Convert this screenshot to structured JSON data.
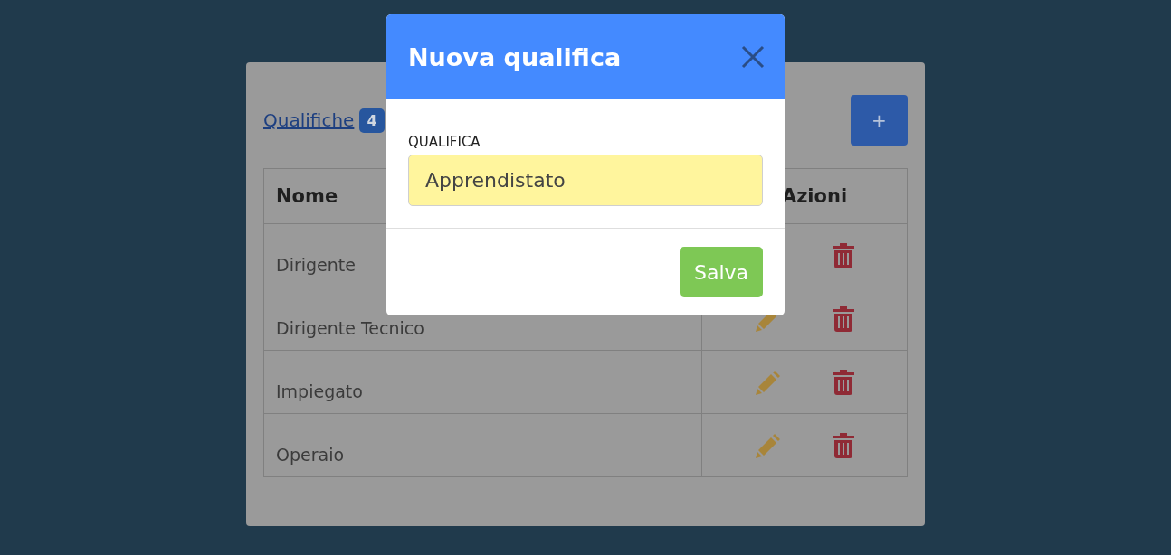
{
  "card": {
    "title_link": "Qualifiche",
    "count_badge": "4",
    "add_button": "+"
  },
  "table": {
    "columns": [
      "Nome",
      "Azioni"
    ],
    "rows": [
      {
        "name": "Dirigente",
        "actions": [
          {
            "kind": "none"
          },
          {
            "kind": "delete"
          }
        ]
      },
      {
        "name": "Dirigente Tecnico",
        "actions": [
          {
            "kind": "edit"
          },
          {
            "kind": "delete"
          }
        ]
      },
      {
        "name": "Impiegato",
        "actions": [
          {
            "kind": "edit"
          },
          {
            "kind": "delete"
          }
        ]
      },
      {
        "name": "Operaio",
        "actions": [
          {
            "kind": "edit"
          },
          {
            "kind": "delete"
          }
        ]
      }
    ]
  },
  "modal": {
    "title": "Nuova qualifica",
    "field_label": "QUALIFICA",
    "field_value": "Apprendistato",
    "save_button": "Salva"
  }
}
